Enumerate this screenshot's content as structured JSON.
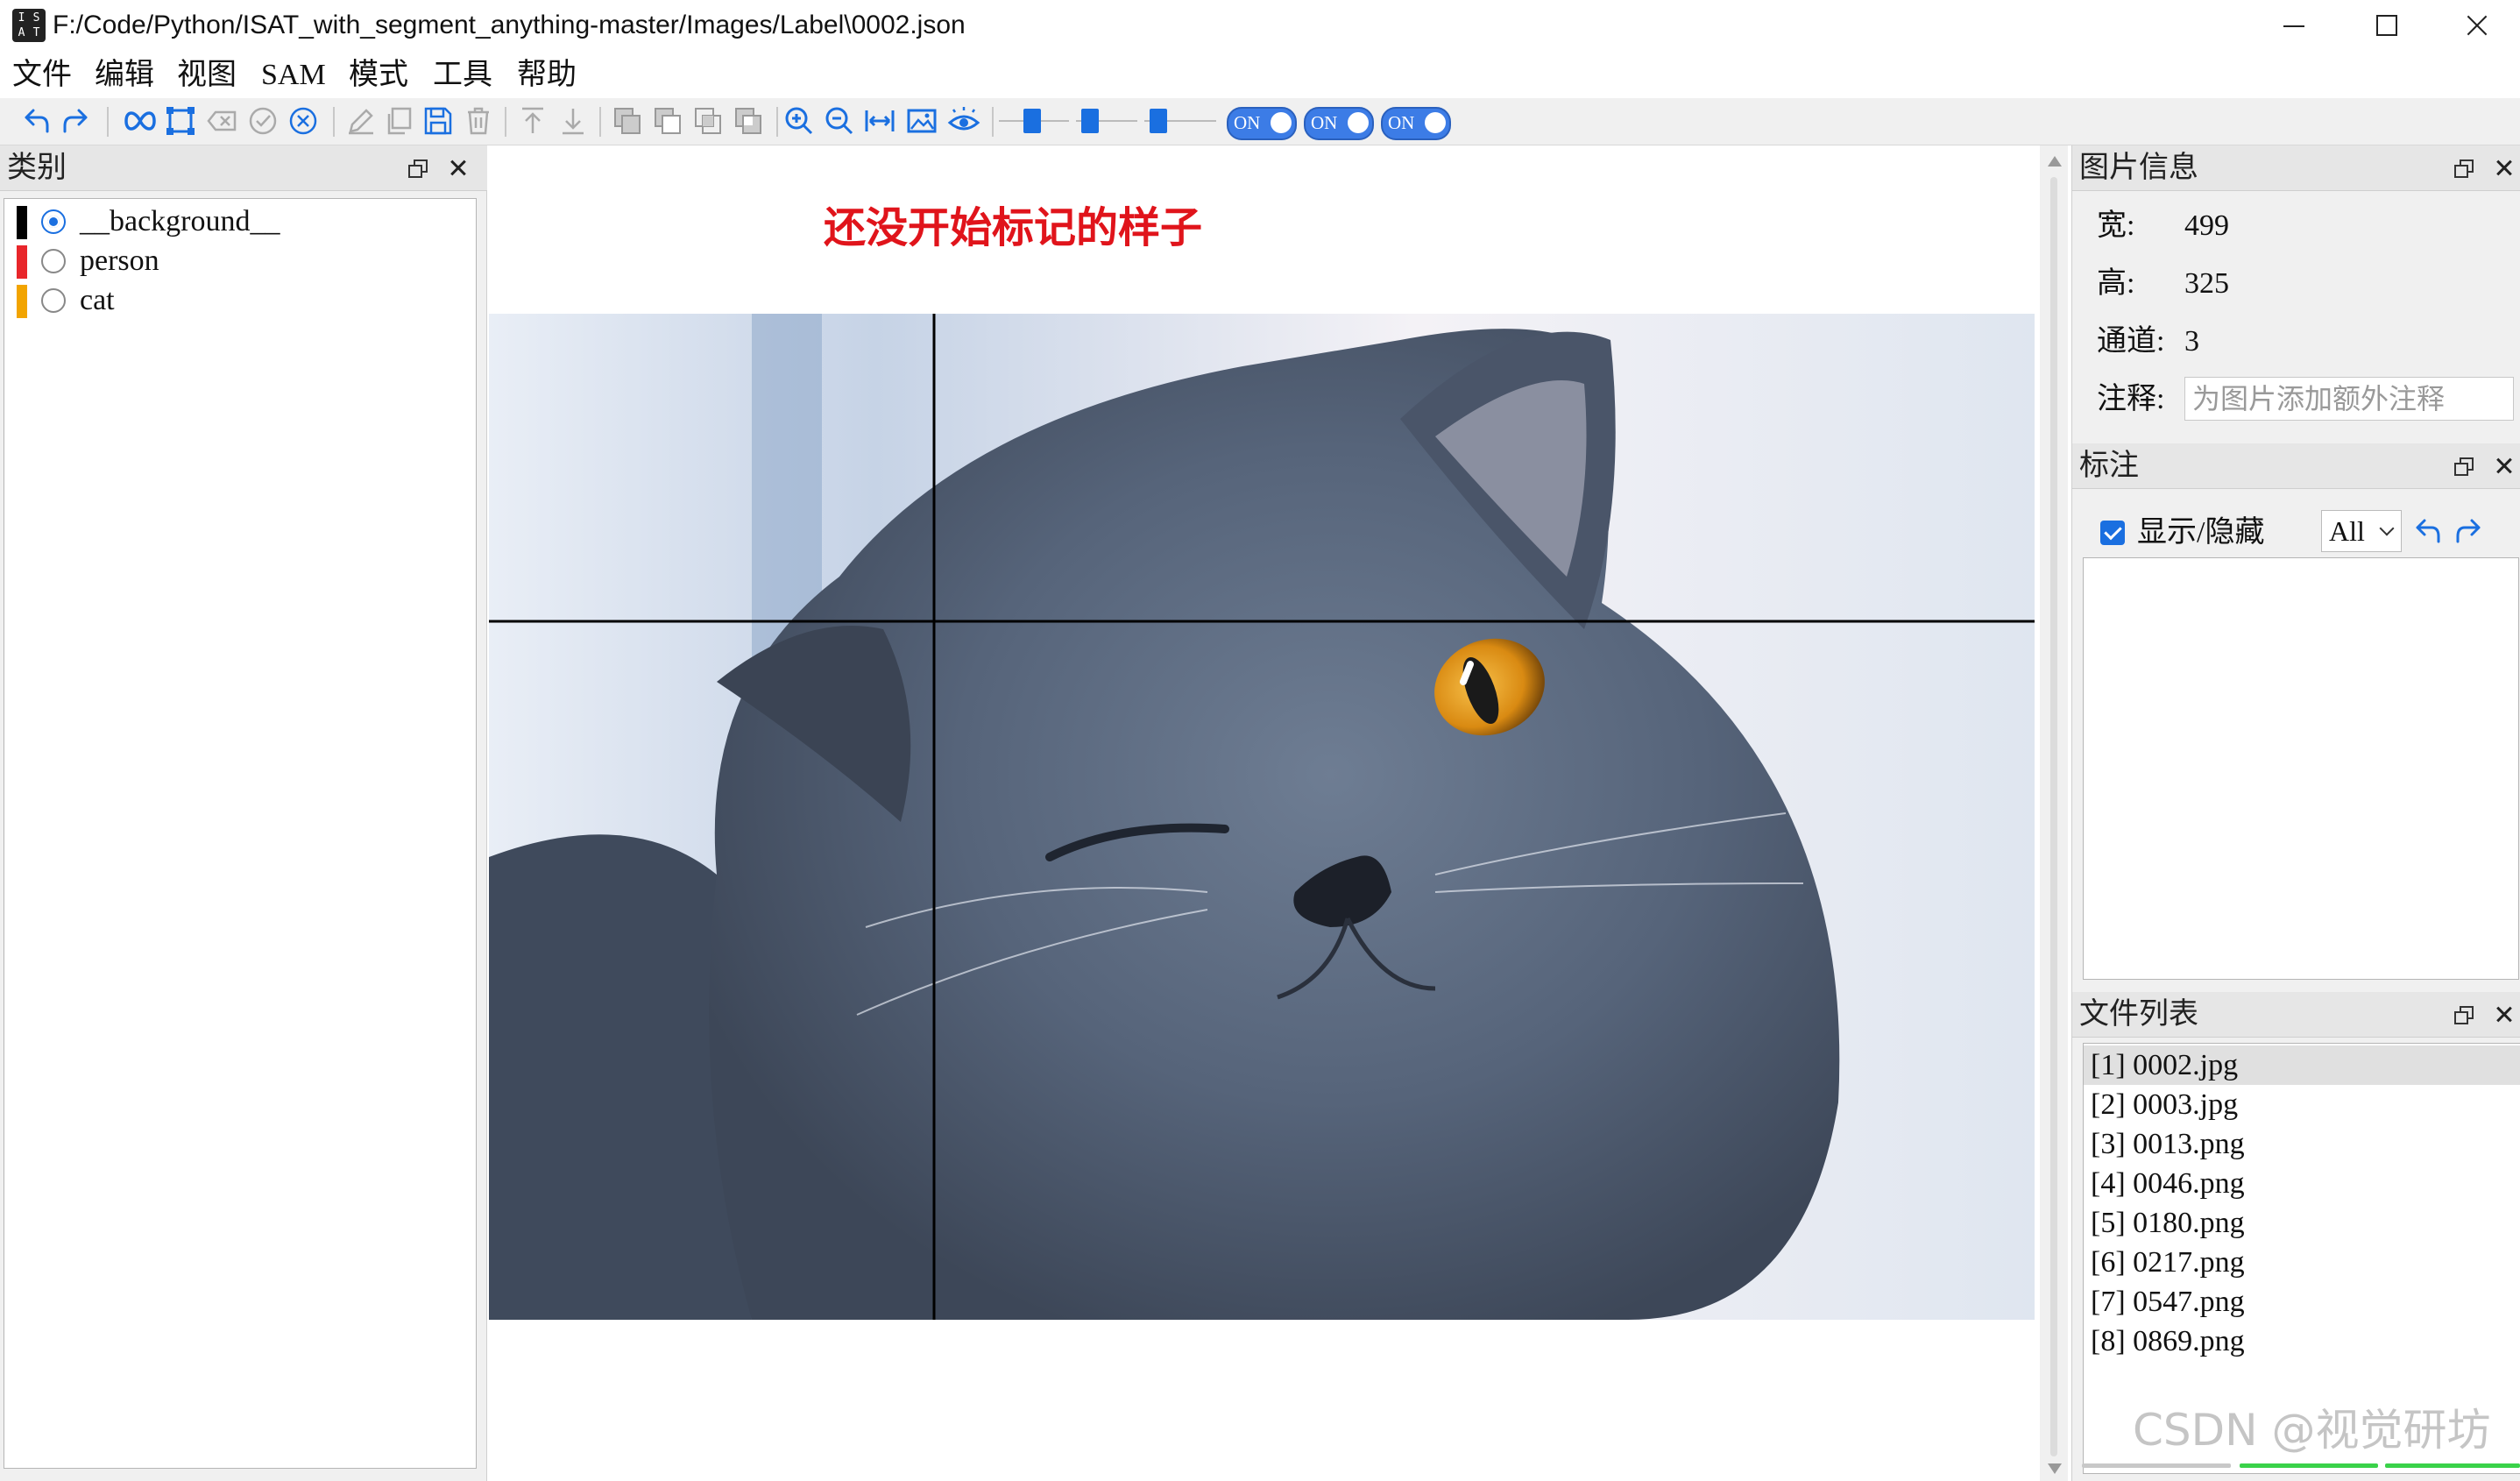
{
  "window": {
    "title": "F:/Code/Python/ISAT_with_segment_anything-master/Images/Label\\0002.json"
  },
  "menu": {
    "items": [
      "文件",
      "编辑",
      "视图",
      "SAM",
      "模式",
      "工具",
      "帮助"
    ]
  },
  "toolbar": {
    "icons": [
      "undo-icon",
      "redo-icon",
      "sam-segment-icon",
      "polygon-icon",
      "delete-point-icon",
      "finish-annotation-icon",
      "cancel-annotation-icon",
      "edit-icon",
      "copy-icon",
      "save-icon",
      "delete-icon",
      "to-top-icon",
      "to-bottom-icon",
      "union-icon",
      "subtract-icon",
      "intersect-icon",
      "exclude-icon",
      "zoom-in-icon",
      "zoom-out-icon",
      "fit-window-icon",
      "image-icon",
      "visibility-icon"
    ],
    "toggles": [
      "ON",
      "ON",
      "ON"
    ],
    "accent": "#1a6fe0"
  },
  "left_panel": {
    "title": "类别",
    "categories": [
      {
        "name": "__background__",
        "color": "#000000",
        "selected": true
      },
      {
        "name": "person",
        "color": "#e8262b",
        "selected": false
      },
      {
        "name": "cat",
        "color": "#f2a400",
        "selected": false
      }
    ]
  },
  "canvas": {
    "annotation_note": "还没开始标记的样子",
    "note_color": "#e0141b"
  },
  "image_info": {
    "title": "图片信息",
    "width_label": "宽:",
    "width_value": "499",
    "height_label": "高:",
    "height_value": "325",
    "channels_label": "通道:",
    "channels_value": "3",
    "note_label": "注释:",
    "note_placeholder": "为图片添加额外注释"
  },
  "labels_panel": {
    "title": "标注",
    "show_hide_label": "显示/隐藏",
    "filter_value": "All"
  },
  "file_list": {
    "title": "文件列表",
    "files": [
      "[1] 0002.jpg",
      "[2] 0003.jpg",
      "[3] 0013.png",
      "[4] 0046.png",
      "[5] 0180.png",
      "[6] 0217.png",
      "[7] 0547.png",
      "[8] 0869.png"
    ]
  },
  "watermark": "CSDN @视觉研坊"
}
